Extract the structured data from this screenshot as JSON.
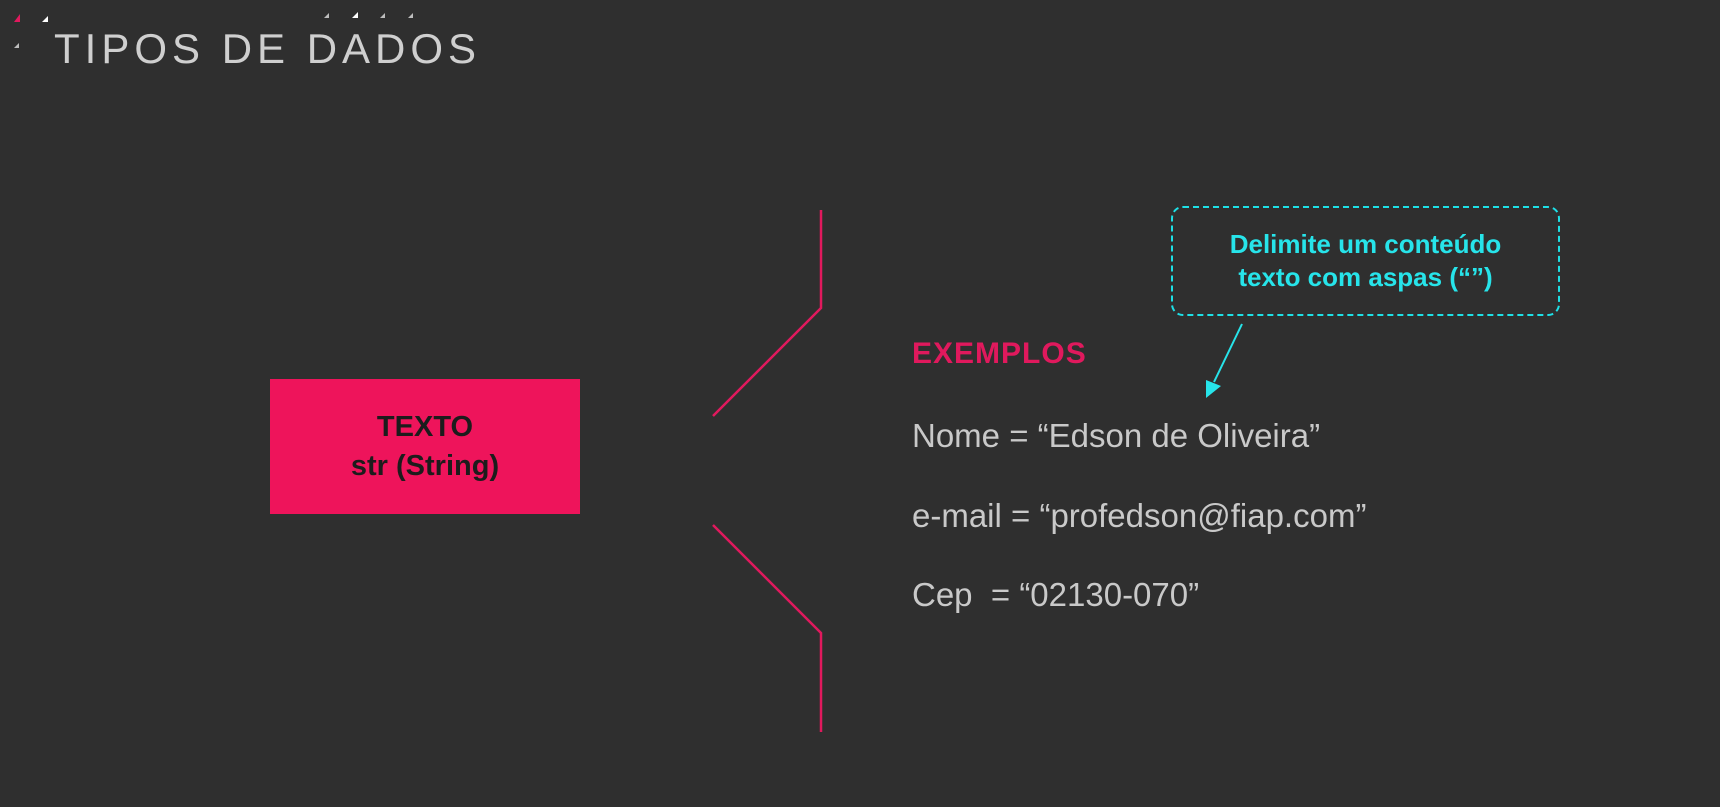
{
  "slide": {
    "title": "TIPOS DE DADOS"
  },
  "type_box": {
    "line1": "TEXTO",
    "line2": "str (String)"
  },
  "examples": {
    "heading": "EXEMPLOS",
    "items": [
      "Nome = “Edson de Oliveira”",
      "e-mail = “profedson@fiap.com”",
      "Cep  = “02130-070”"
    ]
  },
  "callout": {
    "line1": "Delimite um conteúdo",
    "line2": "texto com aspas (“”)"
  },
  "colors": {
    "background": "#2f2f2f",
    "accent": "#ee145b",
    "callout": "#27e4ea",
    "text": "#c9c9c9"
  }
}
